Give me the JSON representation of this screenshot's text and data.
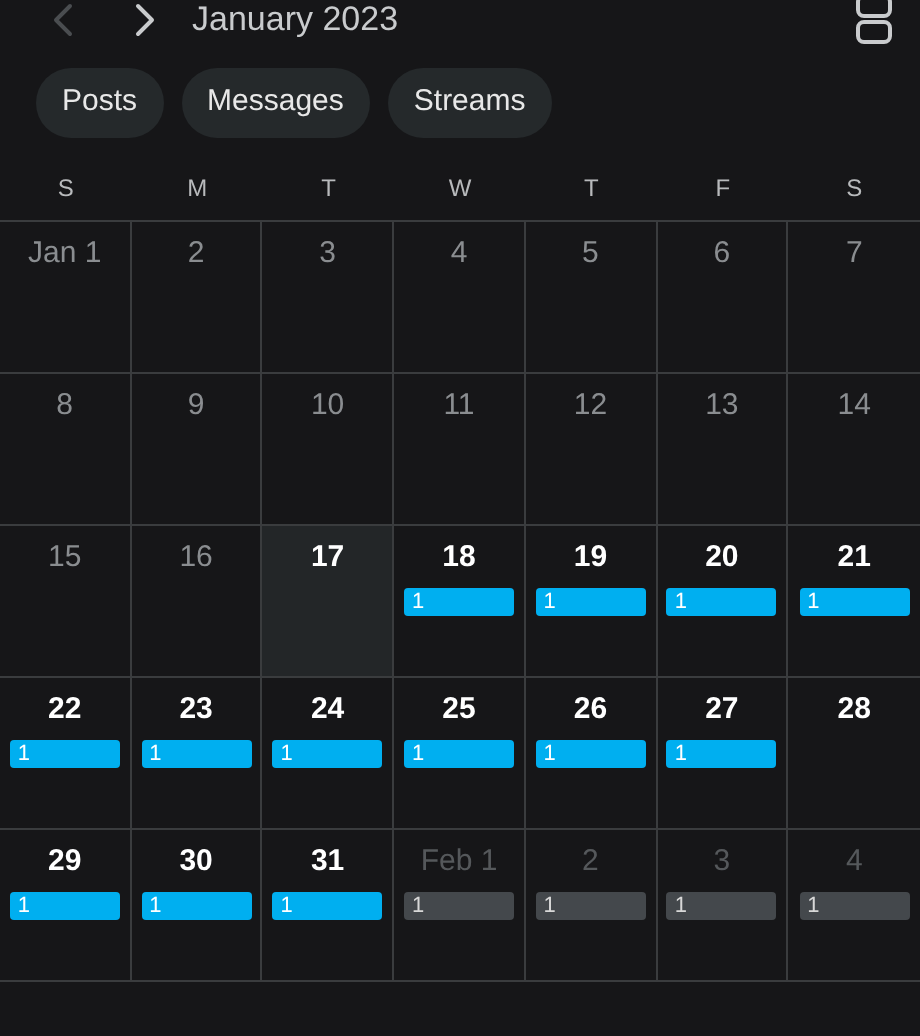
{
  "header": {
    "title": "January 2023",
    "prev_disabled": true,
    "next_disabled": false
  },
  "filters": [
    {
      "label": "Posts"
    },
    {
      "label": "Messages"
    },
    {
      "label": "Streams"
    }
  ],
  "weekdays": [
    "S",
    "M",
    "T",
    "W",
    "T",
    "F",
    "S"
  ],
  "weeks": [
    [
      {
        "label": "Jan 1",
        "kind": "past"
      },
      {
        "label": "2",
        "kind": "past"
      },
      {
        "label": "3",
        "kind": "past"
      },
      {
        "label": "4",
        "kind": "past"
      },
      {
        "label": "5",
        "kind": "past"
      },
      {
        "label": "6",
        "kind": "past"
      },
      {
        "label": "7",
        "kind": "past"
      }
    ],
    [
      {
        "label": "8",
        "kind": "past"
      },
      {
        "label": "9",
        "kind": "past"
      },
      {
        "label": "10",
        "kind": "past"
      },
      {
        "label": "11",
        "kind": "past"
      },
      {
        "label": "12",
        "kind": "past"
      },
      {
        "label": "13",
        "kind": "past"
      },
      {
        "label": "14",
        "kind": "past"
      }
    ],
    [
      {
        "label": "15",
        "kind": "past"
      },
      {
        "label": "16",
        "kind": "past"
      },
      {
        "label": "17",
        "kind": "today"
      },
      {
        "label": "18",
        "kind": "upcoming",
        "badge": "1"
      },
      {
        "label": "19",
        "kind": "upcoming",
        "badge": "1"
      },
      {
        "label": "20",
        "kind": "upcoming",
        "badge": "1"
      },
      {
        "label": "21",
        "kind": "upcoming",
        "badge": "1"
      }
    ],
    [
      {
        "label": "22",
        "kind": "upcoming",
        "badge": "1"
      },
      {
        "label": "23",
        "kind": "upcoming",
        "badge": "1"
      },
      {
        "label": "24",
        "kind": "upcoming",
        "badge": "1"
      },
      {
        "label": "25",
        "kind": "upcoming",
        "badge": "1"
      },
      {
        "label": "26",
        "kind": "upcoming",
        "badge": "1"
      },
      {
        "label": "27",
        "kind": "upcoming",
        "badge": "1"
      },
      {
        "label": "28",
        "kind": "upcoming"
      }
    ],
    [
      {
        "label": "29",
        "kind": "upcoming",
        "badge": "1"
      },
      {
        "label": "30",
        "kind": "upcoming",
        "badge": "1"
      },
      {
        "label": "31",
        "kind": "upcoming",
        "badge": "1"
      },
      {
        "label": "Feb 1",
        "kind": "other",
        "badge": "1"
      },
      {
        "label": "2",
        "kind": "other",
        "badge": "1"
      },
      {
        "label": "3",
        "kind": "other",
        "badge": "1"
      },
      {
        "label": "4",
        "kind": "other",
        "badge": "1"
      }
    ]
  ]
}
